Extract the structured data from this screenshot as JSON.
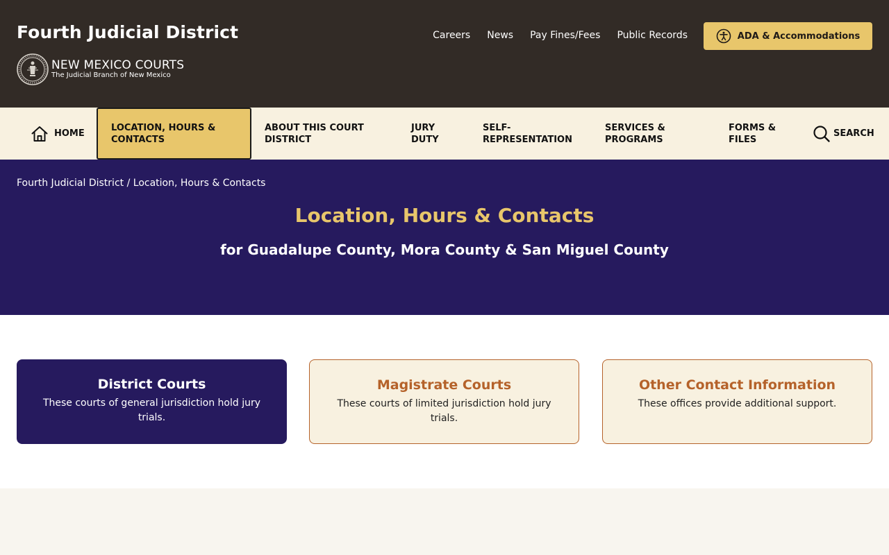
{
  "header": {
    "site_title": "Fourth Judicial District",
    "brand_name": "NEW MEXICO COURTS",
    "brand_tagline": "The Judicial Branch of New Mexico"
  },
  "utility_nav": [
    {
      "label": "Careers"
    },
    {
      "label": "News"
    },
    {
      "label": "Pay Fines/Fees"
    },
    {
      "label": "Public Records"
    }
  ],
  "ada_button": {
    "label": "ADA & Accommodations",
    "icon": "accessibility-icon"
  },
  "main_nav": {
    "home": "HOME",
    "location": "LOCATION, HOURS & CONTACTS",
    "about": "ABOUT THIS COURT DISTRICT",
    "jury": "JURY DUTY",
    "self_rep": "SELF-REPRESENTATION",
    "services": "SERVICES & PROGRAMS",
    "forms": "FORMS & FILES",
    "search": "SEARCH",
    "active": "location"
  },
  "breadcrumb": {
    "home": "Fourth Judicial District",
    "separator": "/",
    "current": "Location, Hours & Contacts"
  },
  "hero": {
    "title": "Location, Hours & Contacts",
    "subtitle": "for Guadalupe County, Mora County & San Miguel County"
  },
  "cards": [
    {
      "title": "District Courts",
      "description": "These courts of general jurisdiction hold jury trials."
    },
    {
      "title": "Magistrate Courts",
      "description": "These courts of limited jurisdiction hold jury trials."
    },
    {
      "title": "Other Contact Information",
      "description": "These offices provide additional support."
    }
  ],
  "colors": {
    "header_bg": "#322b26",
    "nav_bg": "#f8f1e0",
    "accent_gold": "#e8c66b",
    "hero_purple": "#261a5e",
    "card_border": "#b5622a"
  }
}
